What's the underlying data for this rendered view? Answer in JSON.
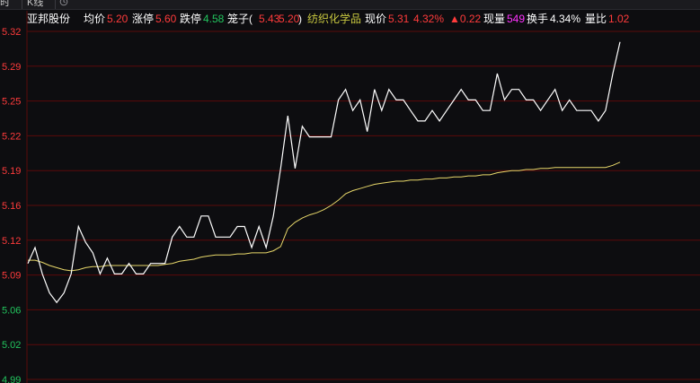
{
  "tabs": [
    {
      "label": "时"
    },
    {
      "label": "K线"
    }
  ],
  "info": {
    "stock_name": "亚邦股份",
    "avg_label": "均价",
    "avg_value": "5.20",
    "limit_up_label": "涨停",
    "limit_up_value": "5.60",
    "limit_down_label": "跌停",
    "limit_down_value": "4.58",
    "cage_label": "笼子(",
    "cage_low": "5.43",
    "cage_high": "5.20",
    "cage_close": ")",
    "sector": "纺织化学品",
    "price_label": "现价",
    "price_value": "5.31",
    "change_pct": "4.32%",
    "change_value": "▲0.22",
    "volume_label": "现量",
    "volume_value": "549",
    "turnover_label": "换手",
    "turnover_value": "4.34%",
    "ratio_label": "量比",
    "ratio_value": "1.02"
  },
  "colors": {
    "background": "#0d0d10",
    "grid": "#5c0a0a",
    "up": "#ff3b3b",
    "down": "#22c55e",
    "price_line": "#ffffff",
    "avg_line": "#e8d86a",
    "sector": "#c9c940",
    "volume": "#ff33ff"
  },
  "chart_data": {
    "type": "line",
    "ylim": [
      4.99,
      5.32
    ],
    "y_ticks": [
      "5.32",
      "5.29",
      "5.25",
      "5.22",
      "5.19",
      "5.16",
      "5.12",
      "5.09",
      "5.06",
      "5.02",
      "4.99"
    ],
    "base_price": 5.09,
    "series": [
      {
        "key": "price",
        "values": [
          5.1,
          5.115,
          5.09,
          5.072,
          5.063,
          5.072,
          5.09,
          5.135,
          5.12,
          5.11,
          5.09,
          5.105,
          5.09,
          5.09,
          5.1,
          5.09,
          5.09,
          5.1,
          5.1,
          5.1,
          5.125,
          5.135,
          5.125,
          5.125,
          5.145,
          5.145,
          5.125,
          5.125,
          5.125,
          5.135,
          5.135,
          5.115,
          5.135,
          5.115,
          5.145,
          5.19,
          5.24,
          5.19,
          5.23,
          5.22,
          5.22,
          5.22,
          5.22,
          5.255,
          5.265,
          5.245,
          5.255,
          5.225,
          5.265,
          5.245,
          5.265,
          5.255,
          5.255,
          5.245,
          5.235,
          5.235,
          5.245,
          5.235,
          5.245,
          5.255,
          5.265,
          5.255,
          5.255,
          5.245,
          5.245,
          5.28,
          5.255,
          5.265,
          5.265,
          5.255,
          5.255,
          5.245,
          5.255,
          5.265,
          5.245,
          5.255,
          5.245,
          5.245,
          5.245,
          5.235,
          5.245,
          5.28,
          5.31
        ]
      },
      {
        "key": "avg",
        "values": [
          5.103,
          5.103,
          5.101,
          5.098,
          5.096,
          5.094,
          5.093,
          5.094,
          5.096,
          5.097,
          5.097,
          5.098,
          5.098,
          5.098,
          5.098,
          5.098,
          5.098,
          5.098,
          5.098,
          5.099,
          5.1,
          5.102,
          5.103,
          5.104,
          5.106,
          5.107,
          5.108,
          5.108,
          5.108,
          5.109,
          5.109,
          5.11,
          5.11,
          5.11,
          5.112,
          5.116,
          5.133,
          5.139,
          5.143,
          5.146,
          5.148,
          5.151,
          5.155,
          5.16,
          5.166,
          5.169,
          5.171,
          5.173,
          5.175,
          5.176,
          5.177,
          5.178,
          5.178,
          5.179,
          5.179,
          5.18,
          5.18,
          5.181,
          5.181,
          5.182,
          5.182,
          5.183,
          5.183,
          5.184,
          5.184,
          5.186,
          5.187,
          5.188,
          5.188,
          5.189,
          5.189,
          5.19,
          5.19,
          5.191,
          5.191,
          5.191,
          5.191,
          5.191,
          5.191,
          5.191,
          5.191,
          5.193,
          5.196
        ]
      }
    ]
  }
}
